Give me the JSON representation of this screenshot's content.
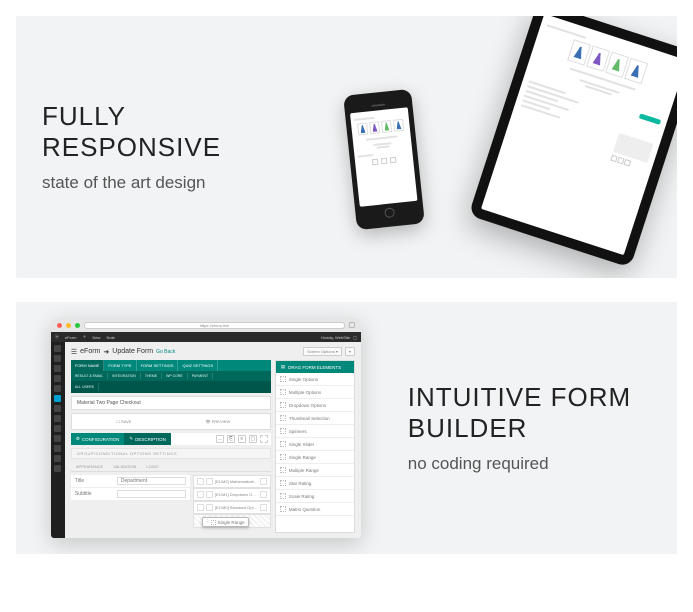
{
  "panel1": {
    "headline": "FULLY RESPONSIVE",
    "subtitle": "state of the art design"
  },
  "panel2": {
    "headline": "INTUITIVE FORM BUILDER",
    "subtitle": "no coding required"
  },
  "browser": {
    "url": "https://eform.live",
    "wp_items": [
      "eForm",
      "New",
      "Note"
    ],
    "wp_user": "Howdy, WebSite",
    "title_pre": "eForm",
    "title_main": "Update Form",
    "go_back": "Go Back",
    "top_button": "Screen Options",
    "main_tabs": [
      "FORM NAME",
      "FORM TYPE",
      "FORM SETTINGS",
      "QUIZ SETTINGS"
    ],
    "sub_tabs": [
      "RESULT & EMAIL",
      "INTEGRATION",
      "THEME",
      "WP CORE",
      "PAYMENT"
    ],
    "sub_tabs2": "ALL USERS",
    "page_card": "Material Two Page Checkout",
    "half_a": "SAVE",
    "half_b": "PREVIEW",
    "conf_a": "CONFIGURATION",
    "conf_b": "DESCRIPTION",
    "group_head": "GROUP/CONDITIONAL OPTIONS SETTINGS",
    "grey_tabs": [
      "APPEARANCE",
      "VALIDATION",
      "LOGIC"
    ],
    "ctrl_rows": [
      "[E1/M2] Mathematical Evalua…",
      "[E1/M1] Dropdown Options",
      "[E1/M0] Standard Options"
    ],
    "field_title": "Title",
    "field_title_val": "Department",
    "field_subtitle": "Subtitle",
    "right_head": "DRAG FORM ELEMENTS",
    "right_items": [
      "Single Options",
      "Multiple Options",
      "Dropdown Options",
      "Thumbnail Selection",
      "Spinners",
      "Single Slider",
      "Single Range",
      "Multiple Range",
      "Star Rating",
      "Scale Rating",
      "Matrix Question"
    ],
    "drag_badge": "Single Range"
  }
}
